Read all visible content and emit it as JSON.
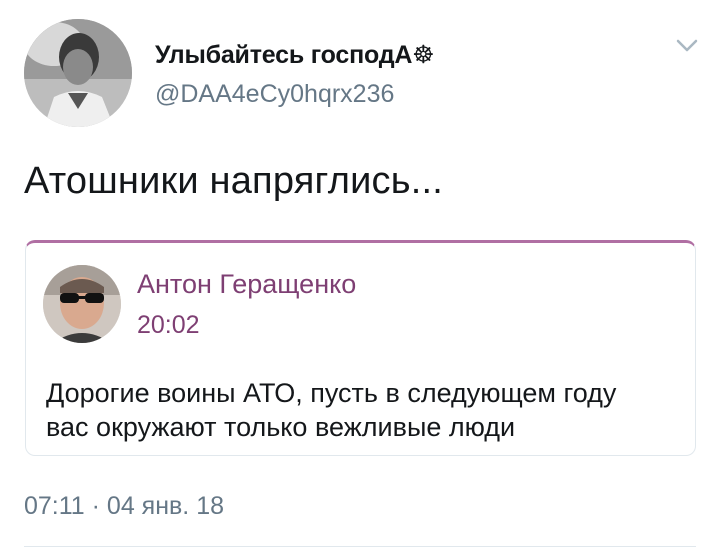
{
  "author": {
    "display_name": "Улыбайтесь господА☸",
    "handle": "@DAA4eCy0hqrx236"
  },
  "tweet": {
    "text": "Атошники напряглись...",
    "timestamp": "07:11 · 04 янв. 18"
  },
  "quoted": {
    "author_name": "Антон Геращенко",
    "time": "20:02",
    "text_lines": [
      "Дорогие воины АТО, пусть в следующем году",
      "вас окружают только вежливые люди"
    ]
  },
  "colors": {
    "quote_accent": "#7e3f73",
    "quote_border_top": "#b06fa3",
    "secondary_text": "#657786"
  },
  "icons": {
    "more": "chevron-down-icon"
  }
}
